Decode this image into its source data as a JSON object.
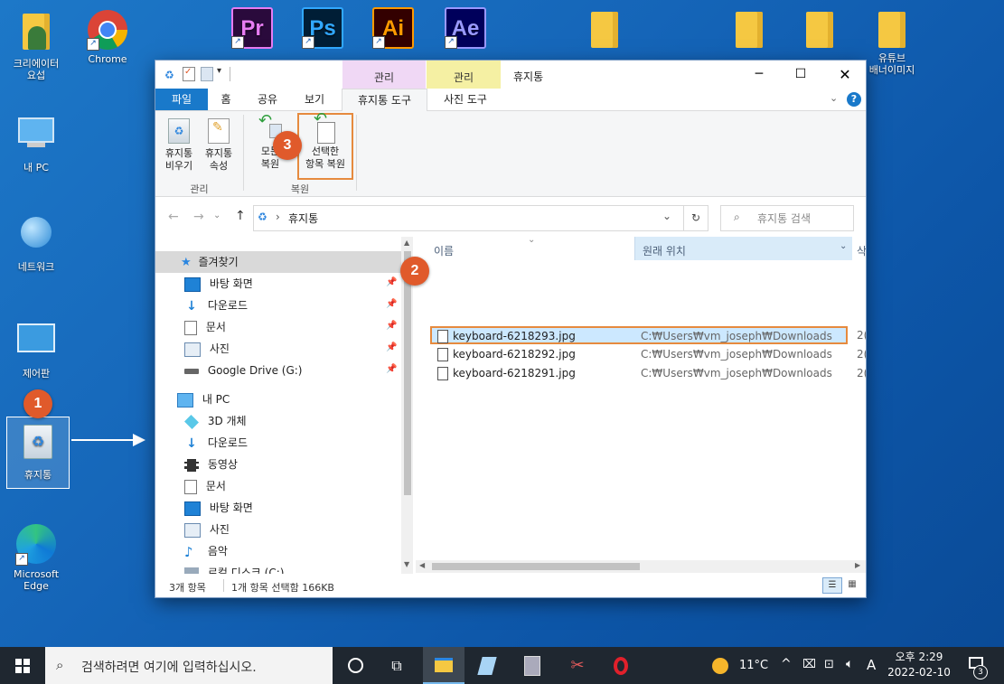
{
  "desktop": {
    "icons": [
      {
        "label": "크리에이터\n요섭"
      },
      {
        "label": "Chrome"
      },
      {
        "label": "내 PC"
      },
      {
        "label": "네트워크"
      },
      {
        "label": "제어판"
      },
      {
        "label": "휴지통"
      },
      {
        "label": "Microsoft\nEdge"
      },
      {
        "label": "유튜브\n배너이미지"
      }
    ],
    "adobe": [
      {
        "abbr": "Pr",
        "color": "#e77cf3",
        "bg": "#2a0a3c"
      },
      {
        "abbr": "Ps",
        "color": "#31a8ff",
        "bg": "#001e36"
      },
      {
        "abbr": "Ai",
        "color": "#ff9a00",
        "bg": "#330000"
      },
      {
        "abbr": "Ae",
        "color": "#9999ff",
        "bg": "#00005b"
      }
    ]
  },
  "markers": [
    "1",
    "2",
    "3"
  ],
  "window": {
    "title": "휴지통",
    "context_tabs": {
      "manage1": "관리",
      "manage2": "관리"
    },
    "tabs": [
      "파일",
      "홈",
      "공유",
      "보기",
      "휴지통 도구",
      "사진 도구"
    ],
    "ribbon": {
      "empty_bin": "휴지통\n비우기",
      "bin_props": "휴지통\n속성",
      "restore_all": "모든\n복원",
      "restore_selected": "선택한\n항목 복원",
      "group_manage": "관리",
      "group_restore": "복원"
    },
    "address": {
      "path": "휴지통",
      "search_placeholder": "휴지통 검색"
    },
    "nav": {
      "quick_access": "즐겨찾기",
      "qa_items": [
        "바탕 화면",
        "다운로드",
        "문서",
        "사진",
        "Google Drive (G:)"
      ],
      "this_pc": "내 PC",
      "pc_items": [
        "3D 개체",
        "다운로드",
        "동영상",
        "문서",
        "바탕 화면",
        "사진",
        "음악",
        "로컬 디스크 (C:)"
      ]
    },
    "columns": {
      "name": "이름",
      "original_location": "원래 위치",
      "extra": "삭"
    },
    "files": [
      {
        "name": "keyboard-6218293.jpg",
        "location": "C:₩Users₩vm_joseph₩Downloads",
        "extra": "2("
      },
      {
        "name": "keyboard-6218292.jpg",
        "location": "C:₩Users₩vm_joseph₩Downloads",
        "extra": "2("
      },
      {
        "name": "keyboard-6218291.jpg",
        "location": "C:₩Users₩vm_joseph₩Downloads",
        "extra": "2("
      }
    ],
    "status": {
      "count": "3개 항목",
      "selection": "1개 항목 선택함 166KB"
    }
  },
  "taskbar": {
    "search_placeholder": "검색하려면 여기에 입력하십시오.",
    "weather": "11°C",
    "ime": "A",
    "time": "오후 2:29",
    "date": "2022-02-10",
    "notifications": "3"
  }
}
